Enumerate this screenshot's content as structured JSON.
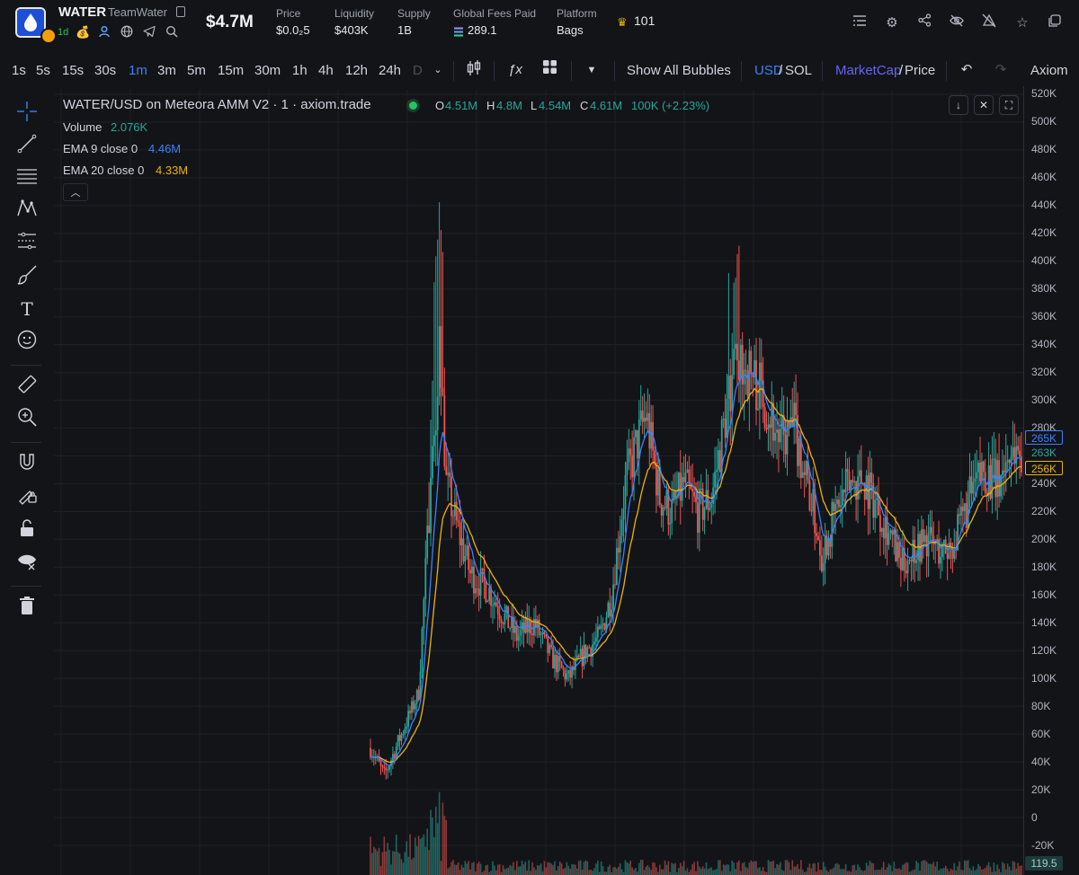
{
  "header": {
    "token_name": "WATER",
    "team_name": "TeamWater",
    "age": "1d",
    "market_cap": "$4.7M",
    "stats": [
      {
        "label": "Price",
        "value": "$0.0₂5"
      },
      {
        "label": "Liquidity",
        "value": "$403K"
      },
      {
        "label": "Supply",
        "value": "1B"
      },
      {
        "label": "Global Fees Paid",
        "value": "289.1"
      },
      {
        "label": "Platform",
        "value": "Bags"
      }
    ],
    "holders": "101",
    "icons": [
      "list-icon",
      "gear-icon",
      "share-icon",
      "eye-off-icon",
      "hide-icon",
      "star-icon"
    ]
  },
  "toolbar": {
    "timeframes": [
      "1s",
      "5s",
      "15s",
      "30s",
      "1m",
      "3m",
      "5m",
      "15m",
      "30m",
      "1h",
      "4h",
      "12h",
      "24h",
      "D"
    ],
    "active_timeframe": "1m",
    "show_all_bubbles": "Show All Bubbles",
    "usd": "USD",
    "sol": "SOL",
    "market_cap": "MarketCap",
    "price": "Price",
    "separator": "/",
    "brand": "Axiom"
  },
  "chart": {
    "title": "WATER/USD on Meteora AMM V2 · 1 · axiom.trade",
    "ohlc": {
      "open_label": "O",
      "open": "4.51M",
      "high_label": "H",
      "high": "4.8M",
      "low_label": "L",
      "low": "4.54M",
      "close_label": "C",
      "close": "4.61M",
      "change": "100K (+2.23%)"
    },
    "volume_label": "Volume",
    "volume_value": "2.076K",
    "ema9_label": "EMA 9 close 0",
    "ema9_value": "4.46M",
    "ema20_label": "EMA 20 close 0",
    "ema20_value": "4.33M",
    "colors": {
      "up": "#26a69a",
      "down": "#ef5350",
      "ema9": "#3b82f6",
      "ema20": "#eab308",
      "background": "#131418",
      "grid": "#1e2129"
    }
  },
  "price_scale": {
    "ticks": [
      "520K",
      "500K",
      "480K",
      "460K",
      "440K",
      "420K",
      "400K",
      "380K",
      "360K",
      "340K",
      "320K",
      "300K",
      "280K",
      "260K",
      "240K",
      "220K",
      "200K",
      "180K",
      "160K",
      "140K",
      "120K",
      "100K",
      "80K",
      "60K",
      "40K",
      "20K",
      "0",
      "-20K"
    ],
    "labels": {
      "ema9": "265K",
      "last": "263K",
      "ema20": "256K",
      "volume": "119.5"
    }
  },
  "chart_data": {
    "type": "candlestick",
    "title": "WATER/USD on Meteora AMM V2 · 1 · axiom.trade",
    "y_unit": "USD market cap",
    "ylim": [
      -20000,
      520000
    ],
    "grid": true,
    "close_series": [
      {
        "i": 0,
        "v": 50000
      },
      {
        "i": 8,
        "v": 30000
      },
      {
        "i": 18,
        "v": 60000
      },
      {
        "i": 28,
        "v": 90000
      },
      {
        "i": 34,
        "v": 220000
      },
      {
        "i": 38,
        "v": 300000
      },
      {
        "i": 40,
        "v": 350000
      },
      {
        "i": 44,
        "v": 240000
      },
      {
        "i": 50,
        "v": 210000
      },
      {
        "i": 58,
        "v": 175000
      },
      {
        "i": 68,
        "v": 165000
      },
      {
        "i": 75,
        "v": 150000
      },
      {
        "i": 85,
        "v": 130000
      },
      {
        "i": 95,
        "v": 140000
      },
      {
        "i": 105,
        "v": 115000
      },
      {
        "i": 115,
        "v": 100000
      },
      {
        "i": 125,
        "v": 120000
      },
      {
        "i": 133,
        "v": 130000
      },
      {
        "i": 140,
        "v": 160000
      },
      {
        "i": 148,
        "v": 240000
      },
      {
        "i": 155,
        "v": 270000
      },
      {
        "i": 160,
        "v": 290000
      },
      {
        "i": 168,
        "v": 230000
      },
      {
        "i": 175,
        "v": 220000
      },
      {
        "i": 182,
        "v": 240000
      },
      {
        "i": 190,
        "v": 220000
      },
      {
        "i": 198,
        "v": 230000
      },
      {
        "i": 205,
        "v": 280000
      },
      {
        "i": 212,
        "v": 335000
      },
      {
        "i": 220,
        "v": 320000
      },
      {
        "i": 228,
        "v": 305000
      },
      {
        "i": 238,
        "v": 270000
      },
      {
        "i": 246,
        "v": 280000
      },
      {
        "i": 254,
        "v": 240000
      },
      {
        "i": 262,
        "v": 190000
      },
      {
        "i": 270,
        "v": 220000
      },
      {
        "i": 278,
        "v": 240000
      },
      {
        "i": 286,
        "v": 245000
      },
      {
        "i": 292,
        "v": 230000
      },
      {
        "i": 300,
        "v": 210000
      },
      {
        "i": 308,
        "v": 180000
      },
      {
        "i": 316,
        "v": 195000
      },
      {
        "i": 324,
        "v": 200000
      },
      {
        "i": 332,
        "v": 190000
      },
      {
        "i": 340,
        "v": 200000
      },
      {
        "i": 348,
        "v": 230000
      },
      {
        "i": 356,
        "v": 250000
      },
      {
        "i": 364,
        "v": 240000
      },
      {
        "i": 372,
        "v": 265000
      },
      {
        "i": 378,
        "v": 263000
      }
    ],
    "ema9_last": 265000,
    "ema20_last": 256000,
    "last_volume": 119.5
  }
}
